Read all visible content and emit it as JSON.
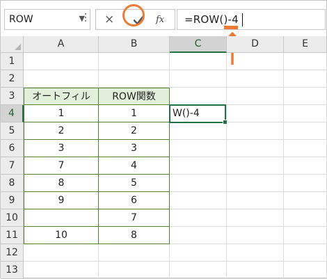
{
  "formula_bar": {
    "name_box": "ROW",
    "formula": "=ROW()-4",
    "cancel_icon": "×",
    "confirm_icon": "✔",
    "fx_label": "fx"
  },
  "columns": [
    "A",
    "B",
    "C",
    "D",
    "E"
  ],
  "rows": [
    "1",
    "2",
    "3",
    "4",
    "5",
    "6",
    "7",
    "8",
    "9",
    "10",
    "11",
    "12",
    "13"
  ],
  "selected_column": "C",
  "selected_row": "4",
  "table": {
    "header": [
      "オートフィル",
      "ROW関数"
    ],
    "rows": [
      [
        "1",
        "1"
      ],
      [
        "2",
        "2"
      ],
      [
        "3",
        "3"
      ],
      [
        "7",
        "4"
      ],
      [
        "8",
        "5"
      ],
      [
        "9",
        "6"
      ],
      [
        "",
        "7"
      ],
      [
        "10",
        "8"
      ]
    ]
  },
  "active_cell": {
    "ref": "C4",
    "value": "W()-4"
  },
  "colors": {
    "accent": "#ee7a35",
    "excel_green": "#217346",
    "table_header": "#e2efda",
    "table_border": "#548235"
  }
}
